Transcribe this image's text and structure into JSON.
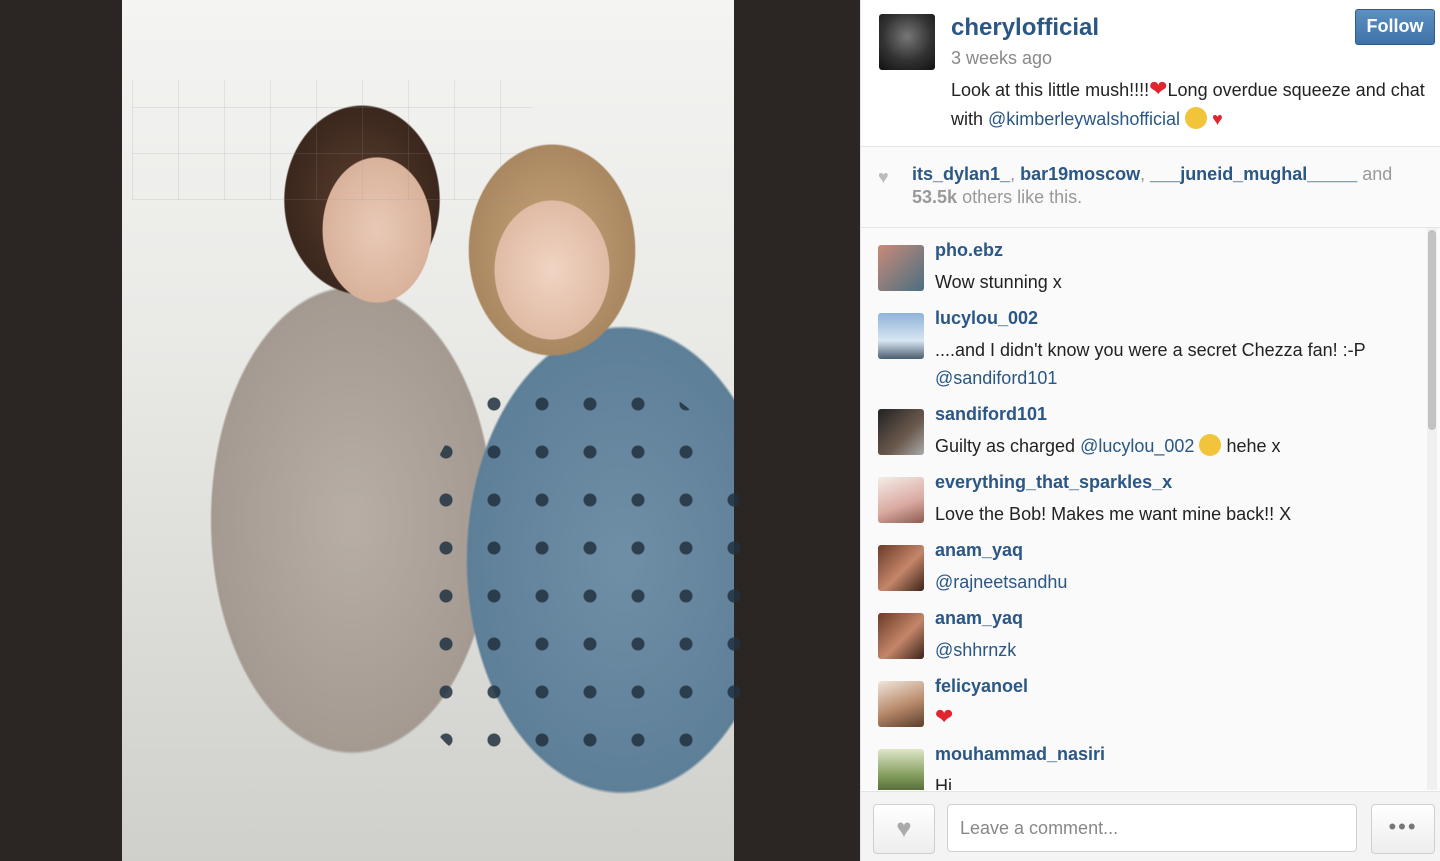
{
  "post": {
    "username": "cherylofficial",
    "timestamp": "3 weeks ago",
    "follow_label": "Follow",
    "caption_text": "Look at this little mush!!!!",
    "caption_text2": "Long overdue squeeze and chat with ",
    "caption_mention": "@kimberleywalshofficial"
  },
  "likes": {
    "users": [
      "its_dylan1_",
      "bar19moscow",
      "___juneid_mughal_____"
    ],
    "and": "and",
    "count": "53.5k",
    "suffix": "others like this."
  },
  "comments": [
    {
      "user": "pho.ebz",
      "text": "Wow stunning x"
    },
    {
      "user": "lucylou_002",
      "text": "....and I didn't know you were a secret Chezza fan! :-P",
      "mention": "@sandiford101"
    },
    {
      "user": "sandiford101",
      "text_before": "Guilty as charged ",
      "mention": "@lucylou_002",
      "text_after": " hehe x"
    },
    {
      "user": "everything_that_sparkles_x",
      "text": "Love the Bob! Makes me want mine back!! X"
    },
    {
      "user": "anam_yaq",
      "mention": "@rajneetsandhu"
    },
    {
      "user": "anam_yaq",
      "mention": "@shhrnzk"
    },
    {
      "user": "felicyanoel",
      "icon": "red-heart-emoji"
    },
    {
      "user": "mouhammad_nasiri",
      "text": "Hi"
    }
  ],
  "footer": {
    "comment_placeholder": "Leave a comment...",
    "more_label": "•••"
  },
  "colors": {
    "link": "#2a5785",
    "follow_button": "#4a7fb5",
    "heart": "#e0252e"
  }
}
